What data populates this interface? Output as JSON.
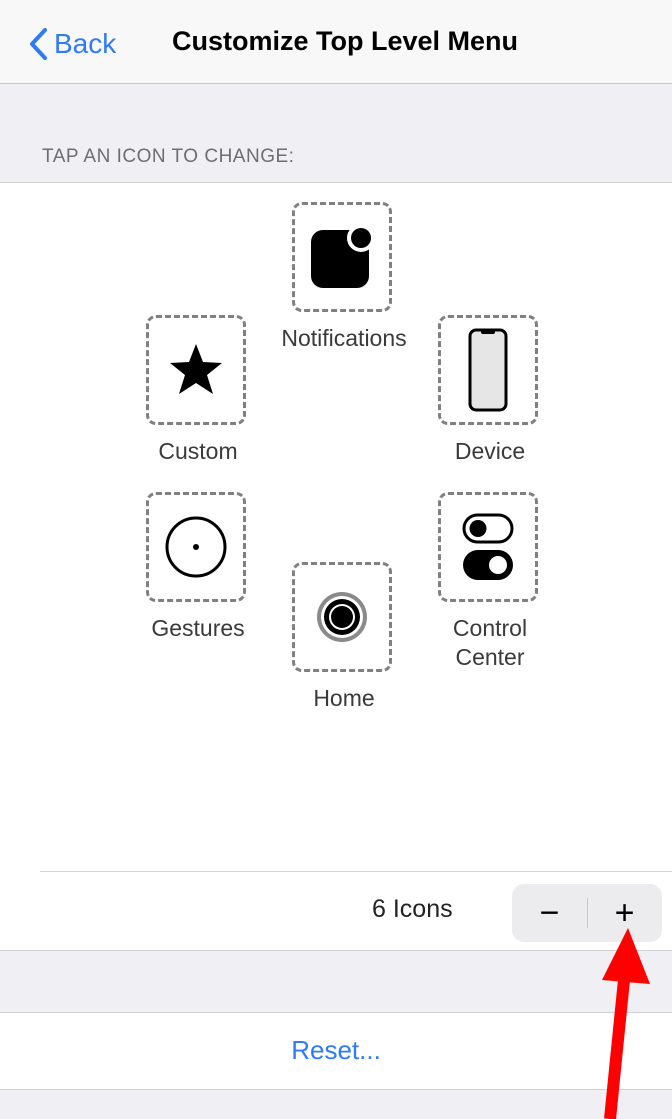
{
  "navbar": {
    "back_label": "Back",
    "title": "Customize Top Level Menu"
  },
  "section": {
    "header": "TAP AN ICON TO CHANGE:"
  },
  "slots": [
    {
      "label": "Notifications",
      "icon": "notification-badge-icon"
    },
    {
      "label": "Custom",
      "icon": "star-icon"
    },
    {
      "label": "Device",
      "icon": "phone-device-icon"
    },
    {
      "label": "Gestures",
      "icon": "gestures-circle-icon"
    },
    {
      "label": "Control\nCenter",
      "icon": "toggle-switches-icon"
    },
    {
      "label": "Home",
      "icon": "home-button-icon"
    }
  ],
  "icon_count": {
    "label": "6 Icons",
    "value": 6,
    "minus": "−",
    "plus": "+"
  },
  "reset": {
    "label": "Reset..."
  },
  "colors": {
    "accent": "#2f7bf5",
    "annotation_arrow": "#ff0000"
  }
}
